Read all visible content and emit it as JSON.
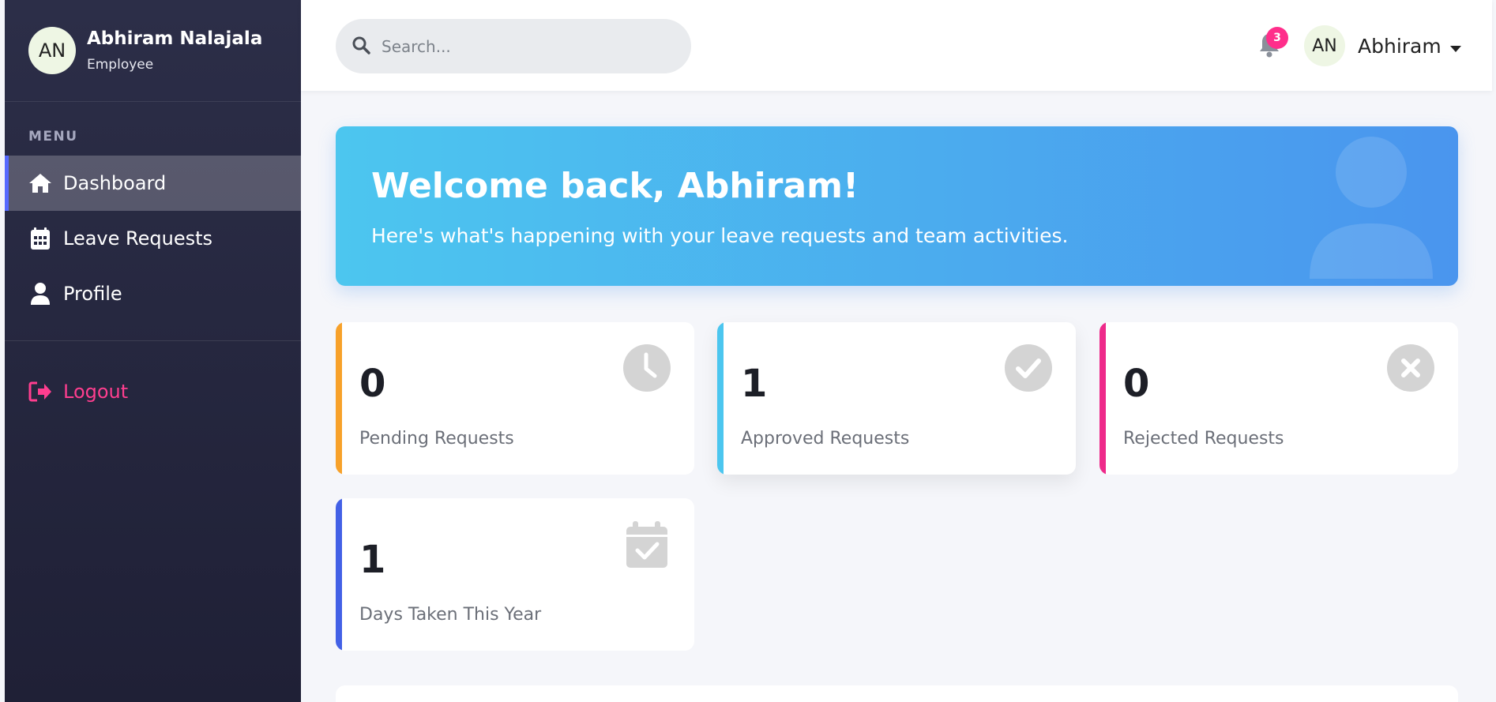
{
  "user": {
    "initials": "AN",
    "name": "Abhiram Nalajala",
    "role": "Employee",
    "first_name": "Abhiram"
  },
  "sidebar": {
    "menu_label": "MENU",
    "items": [
      {
        "label": "Dashboard",
        "icon": "home-icon",
        "active": true
      },
      {
        "label": "Leave Requests",
        "icon": "calendar-icon",
        "active": false
      },
      {
        "label": "Profile",
        "icon": "user-icon",
        "active": false
      }
    ],
    "logout_label": "Logout"
  },
  "header": {
    "search_placeholder": "Search...",
    "notification_count": "3"
  },
  "welcome": {
    "title": "Welcome back, Abhiram!",
    "subtitle": "Here's what's happening with your leave requests and team activities."
  },
  "stats": [
    {
      "value": "0",
      "label": "Pending Requests",
      "color": "#f7a12a",
      "icon": "clock-icon"
    },
    {
      "value": "1",
      "label": "Approved Requests",
      "color": "#4cc6ef",
      "icon": "check-circle-icon"
    },
    {
      "value": "0",
      "label": "Rejected Requests",
      "color": "#ee2a8a",
      "icon": "x-circle-icon"
    },
    {
      "value": "1",
      "label": "Days Taken This Year",
      "color": "#4361e6",
      "icon": "calendar-check-icon"
    }
  ]
}
